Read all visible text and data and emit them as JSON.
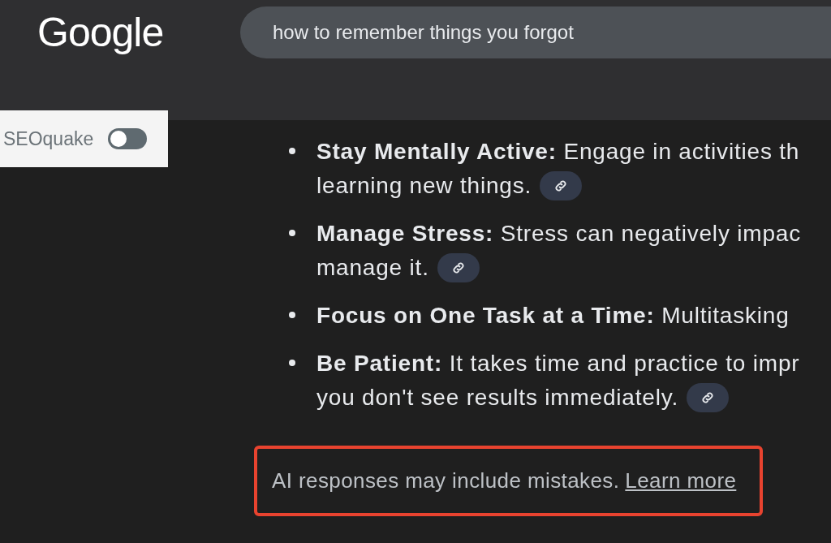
{
  "logo": "Google",
  "search": {
    "value": "how to remember things you forgot"
  },
  "extension": {
    "label": "SEOquake",
    "on": false
  },
  "bullets": [
    {
      "lines": [
        "**Stay Mentally Active:** Engage in activities th",
        "learning new things."
      ],
      "citation": true
    },
    {
      "lines": [
        "**Manage Stress:** Stress can negatively impac",
        "manage it."
      ],
      "citation": true
    },
    {
      "lines": [
        "**Focus on One Task at a Time:** Multitasking"
      ],
      "citation": false
    },
    {
      "lines": [
        "**Be Patient:** It takes time and practice to impr",
        "you don't see results immediately."
      ],
      "citation": true
    }
  ],
  "disclaimer": {
    "text": "AI responses may include mistakes.",
    "link": "Learn more",
    "highlighted": true
  }
}
